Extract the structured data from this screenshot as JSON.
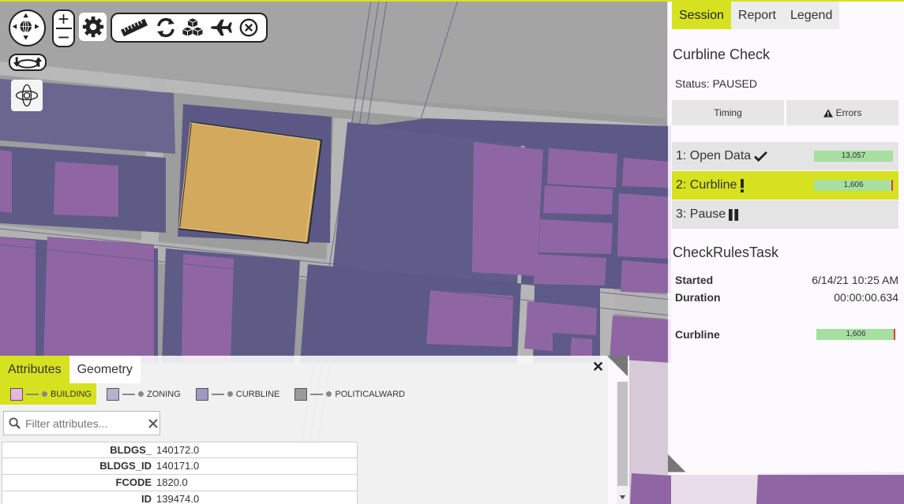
{
  "session_panel": {
    "tabs": [
      "Session",
      "Report",
      "Legend"
    ],
    "title": "Curbline Check",
    "status": "Status: PAUSED",
    "buttons": {
      "timing": "Timing",
      "errors": "Errors"
    },
    "steps": [
      {
        "label": "1: Open Data",
        "count": "13,057",
        "icon": "check-icon"
      },
      {
        "label": "2: Curbline",
        "count": "1,606",
        "icon": "exclamation-icon"
      },
      {
        "label": "3: Pause",
        "icon": "pause-icon"
      }
    ],
    "task": {
      "title": "CheckRulesTask",
      "started_label": "Started",
      "started_value": "6/14/21 10:25 AM",
      "duration_label": "Duration",
      "duration_value": "00:00:00.634",
      "curbline_label": "Curbline",
      "curbline_count": "1,606"
    }
  },
  "attributes_panel": {
    "tabs": [
      "Attributes",
      "Geometry"
    ],
    "layers": [
      {
        "name": "BUILDING",
        "color": "#e8b7e0"
      },
      {
        "name": "ZONING",
        "color": "#b7b1cf"
      },
      {
        "name": "CURBLINE",
        "color": "#9e9ac0"
      },
      {
        "name": "POLITICALWARD",
        "color": "#9a9a9a"
      }
    ],
    "filter_placeholder": "Filter attributes...",
    "rows": [
      {
        "key": "BLDGS_",
        "value": "140172.0"
      },
      {
        "key": "BLDGS_ID",
        "value": "140171.0"
      },
      {
        "key": "FCODE",
        "value": "1820.0"
      },
      {
        "key": "ID",
        "value": "139474.0"
      }
    ]
  },
  "toolbar": {
    "icons": [
      "pan-compass-icon",
      "zoom-in-icon",
      "zoom-out-icon",
      "settings-gear-icon",
      "measure-ruler-icon",
      "refresh-icon",
      "boxes-icon",
      "airplane-icon",
      "close-circle-icon",
      "tilt-icon",
      "orbit-icon"
    ]
  },
  "colors": {
    "accent": "#d6e21f",
    "selected_building": "#d3a95e",
    "building": "#8f66a3",
    "zoning": "#5c5985",
    "success_bar": "#a6dfa0"
  }
}
